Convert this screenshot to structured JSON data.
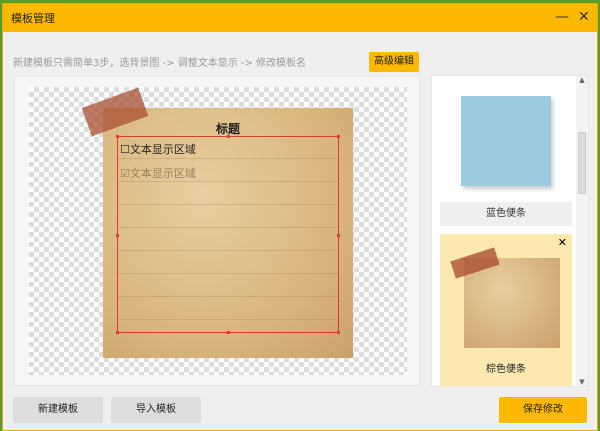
{
  "window": {
    "title": "模板管理",
    "minimize_icon": "minimize-icon",
    "close_icon": "close-icon"
  },
  "hint": "新建模板只需简单3步，选背景图 -> 调整文本显示 -> 修改模板名",
  "advanced_edit": "高级编辑",
  "editor": {
    "title": "标题",
    "rows": [
      {
        "label": "文本显示区域",
        "checked": false
      },
      {
        "label": "文本显示区域",
        "checked": true
      }
    ]
  },
  "templates": [
    {
      "name": "蓝色便条",
      "color": "#9ecbe0"
    },
    {
      "name": "棕色便条",
      "color": "#d9b47c",
      "selected": true
    }
  ],
  "buttons": {
    "new": "新建模板",
    "import": "导入模板",
    "save": "保存修改"
  },
  "colors": {
    "accent": "#fdb900"
  }
}
